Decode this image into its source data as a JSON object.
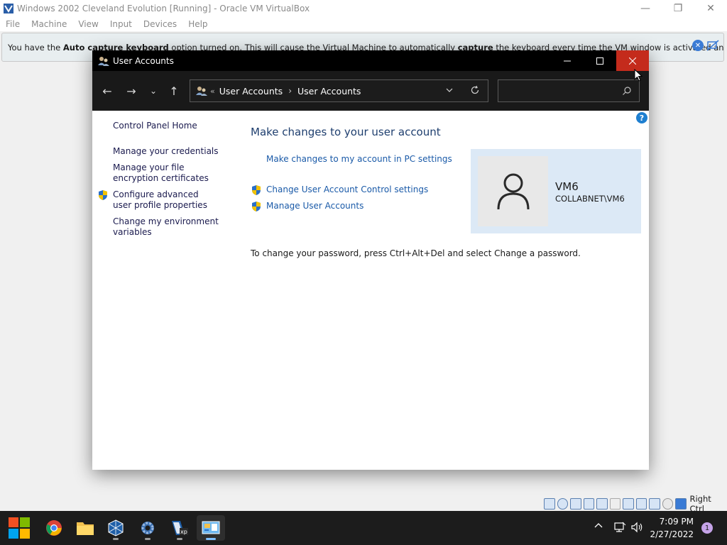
{
  "vbox": {
    "title": "Windows 2002 Cleveland Evolution [Running] - Oracle VM VirtualBox",
    "menu": [
      "File",
      "Machine",
      "View",
      "Input",
      "Devices",
      "Help"
    ],
    "notice": {
      "p1": "You have the ",
      "b1": "Auto capture keyboard",
      "p2": " option turned on. This will cause the Virtual Machine to automatically ",
      "b2": "capture",
      "p3": " the keyboard every time the VM window is activated and make it unavailable to"
    },
    "host_key": "Right Ctrl"
  },
  "window": {
    "title": "User Accounts",
    "breadcrumb_sep": "«",
    "breadcrumbs": [
      "User Accounts",
      "User Accounts"
    ],
    "search_placeholder": "",
    "help_label": "?"
  },
  "left_pane": {
    "home": "Control Panel Home",
    "credentials": "Manage your credentials",
    "encryption": "Manage your file encryption certificates",
    "advanced_profile": "Configure advanced user profile properties",
    "env_vars": "Change my environment variables"
  },
  "main": {
    "heading": "Make changes to your user account",
    "pc_settings_link": "Make changes to my account in PC settings",
    "uac_link": "Change User Account Control settings",
    "manage_link": "Manage User Accounts",
    "password_note": "To change your password, press Ctrl+Alt+Del and select Change a password."
  },
  "user": {
    "name": "VM6",
    "domain": "COLLABNET\\VM6"
  },
  "taskbar": {
    "time": "7:09 PM",
    "date": "2/27/2022",
    "notification_count": "1"
  },
  "colors": {
    "close_red": "#c42b1c",
    "link_blue": "#1a5aa8",
    "card_blue": "#dce9f6",
    "taskbar": "#1c1c1c"
  }
}
